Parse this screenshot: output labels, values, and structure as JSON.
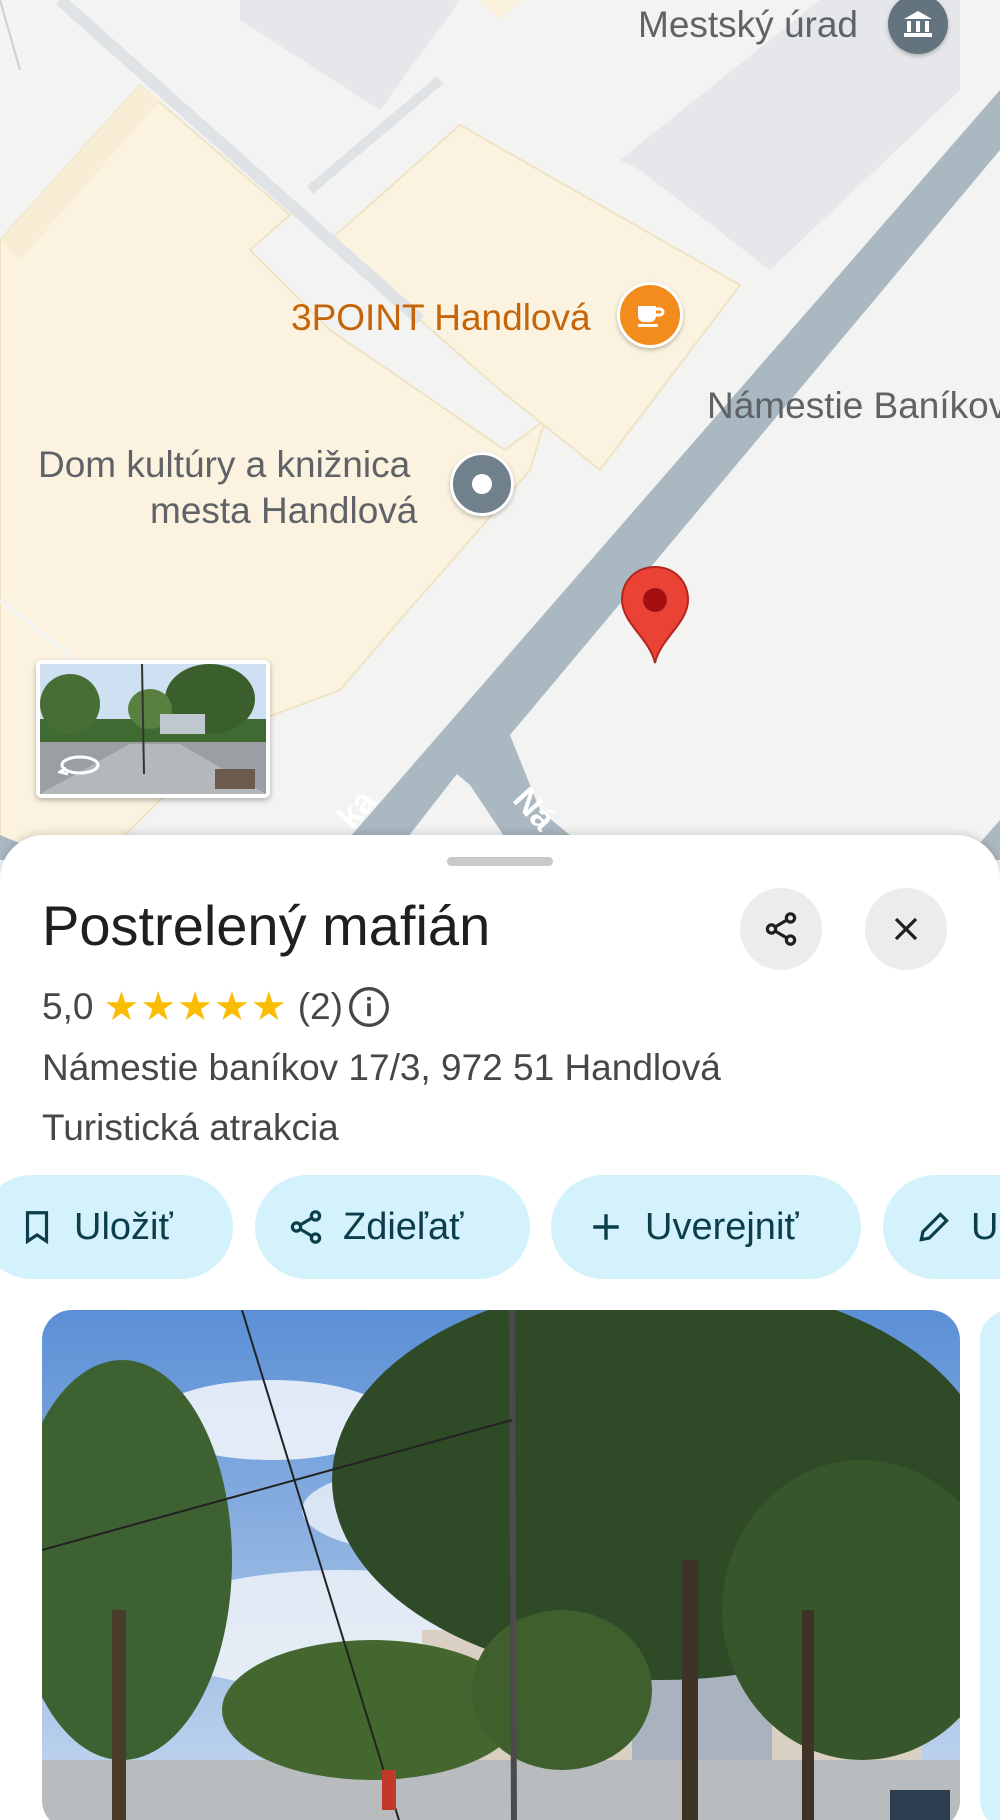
{
  "map": {
    "labels": {
      "city_office": "Mestský úrad",
      "cafe": "3POINT Handlová",
      "square": "Námestie Baníkov",
      "culture_line1": "Dom kultúry a knižnica",
      "culture_line2": "mesta Handlová",
      "street_a": "ka",
      "street_b": "Ná"
    },
    "icons": [
      "city-hall-icon",
      "coffee-cup-icon",
      "place-dot-icon",
      "red-location-pin-icon",
      "street-view-rotate-icon"
    ],
    "colors": {
      "cafe_accent": "#e8710a",
      "pin": "#ea4335",
      "road": "#aab8c2"
    }
  },
  "place": {
    "name": "Postrelený mafián",
    "rating": "5,0",
    "stars": "★★★★★",
    "review_count": "(2)",
    "address": "Námestie baníkov 17/3, 972 51 Handlová",
    "category": "Turistická atrakcia"
  },
  "actions": {
    "save": "Uložiť",
    "share": "Zdieľať",
    "post": "Uverejniť",
    "edit": "U"
  },
  "colors": {
    "chip_bg": "#d3f2fb",
    "star": "#fbbc04"
  }
}
